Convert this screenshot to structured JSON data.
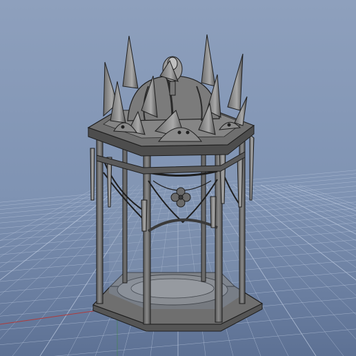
{
  "viewport": {
    "background_top": "#8ea0bd",
    "background_bottom": "#5d7194",
    "grid_color": "#b9c6dc",
    "axis_color": "#b03a3a"
  },
  "model": {
    "kind": "gothic-lantern-3d-model",
    "body_color": "#6f6f6f",
    "edge_color": "#1e1e1e",
    "glass_color": "#8a9ab5"
  }
}
